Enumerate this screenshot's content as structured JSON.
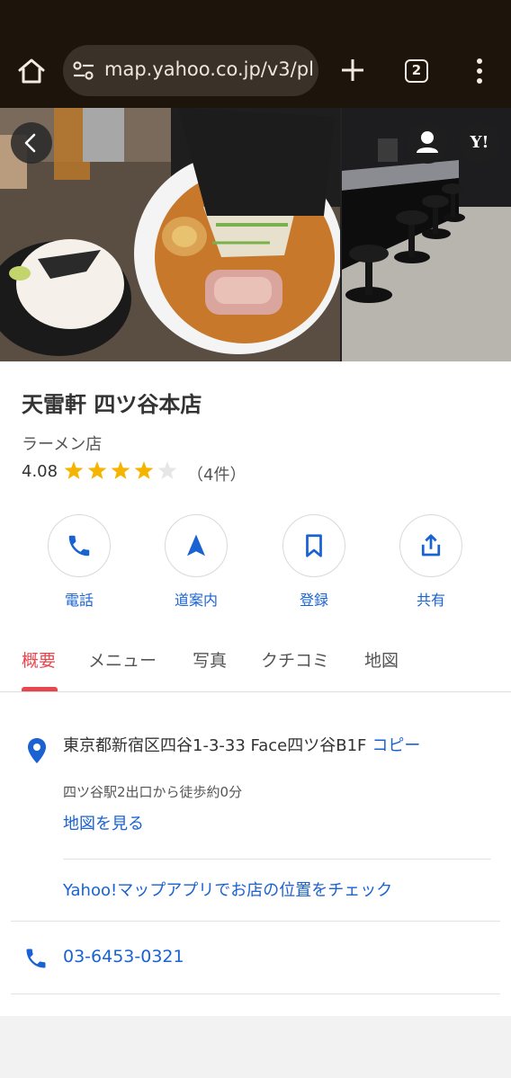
{
  "browser": {
    "url": "map.yahoo.co.jp/v3/pl",
    "tab_count": "2"
  },
  "header_buttons": {
    "yahoo_logo_text": "Y!"
  },
  "place": {
    "name": "天雷軒 四ツ谷本店",
    "category": "ラーメン店",
    "rating": "4.08",
    "rating_stars": 4,
    "rating_max": 5,
    "review_count": "（4件）"
  },
  "actions": [
    {
      "label": "電話",
      "icon": "phone-icon"
    },
    {
      "label": "道案内",
      "icon": "navigation-arrow-icon"
    },
    {
      "label": "登録",
      "icon": "bookmark-icon"
    },
    {
      "label": "共有",
      "icon": "share-icon"
    }
  ],
  "tabs": [
    {
      "label": "概要",
      "active": true
    },
    {
      "label": "メニュー",
      "active": false
    },
    {
      "label": "写真",
      "active": false
    },
    {
      "label": "クチコミ",
      "active": false
    },
    {
      "label": "地図",
      "active": false
    }
  ],
  "info": {
    "address": "東京都新宿区四谷1-3-33 Face四ツ谷B1F",
    "copy_label": "コピー",
    "access": "四ツ谷駅2出口から徒歩約0分",
    "map_link": "地図を見る",
    "app_link": "Yahoo!マップアプリでお店の位置をチェック",
    "phone": "03-6453-0321"
  },
  "colors": {
    "accent_red": "#e8464f",
    "link_blue": "#1a62d2",
    "star_gold": "#f5b400",
    "browser_bar": "#1d140b"
  }
}
